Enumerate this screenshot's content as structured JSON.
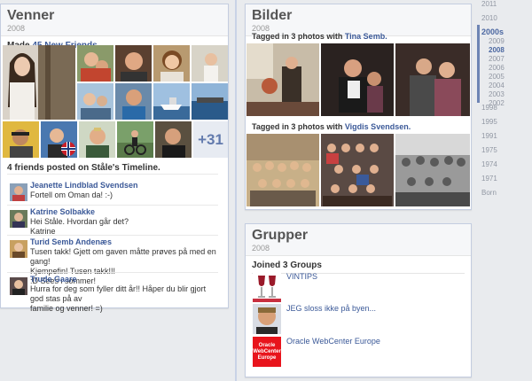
{
  "friends": {
    "title": "Venner",
    "year": "2008",
    "made_prefix": "Made",
    "made_link": "45 New Friends",
    "more_count": "+31",
    "timeline_label": "4 friends posted on Ståle's Timeline.",
    "posts": [
      {
        "name": "Jeanette Lindblad Svendsen",
        "lines": [
          "Fortell om Oman da! :-)"
        ]
      },
      {
        "name": "Katrine Solbakke",
        "lines": [
          "Hei Ståle. Hvordan går det?",
          "Katrine"
        ]
      },
      {
        "name": "Turid Semb Andenæs",
        "lines": [
          "Tusen takk! Gjett om gaven måtte prøves på med en gang!",
          "Kjempefin! Tusen takk!!!",
          ":D Sees i sommer!"
        ]
      },
      {
        "name": "Trude Gaare",
        "lines": [
          "Hurra for deg som fyller ditt år!! Håper du blir gjort god stas på av",
          "familie og venner! =)"
        ]
      }
    ]
  },
  "photos": {
    "title": "Bilder",
    "year": "2008",
    "tag1_prefix": "Tagged in 3 photos with",
    "tag1_name": "Tina Semb.",
    "tag2_prefix": "Tagged in 3 photos with",
    "tag2_name": "Vigdis Svendsen."
  },
  "groups": {
    "title": "Grupper",
    "year": "2008",
    "joined_label": "Joined 3 Groups",
    "items": [
      {
        "name": "VINTIPS"
      },
      {
        "name": "JEG sloss ikke på byen..."
      },
      {
        "name": "Oracle WebCenter Europe",
        "logo_text": "Oracle WebCenter Europe"
      }
    ]
  },
  "timeline": {
    "top": [
      "2011",
      "2010"
    ],
    "active": "2000s",
    "sub": [
      "2009",
      "2008",
      "2007",
      "2006",
      "2005",
      "2004",
      "2003",
      "2002"
    ],
    "selected_sub": "2008",
    "rest": [
      "1998",
      "1995",
      "1991",
      "1975",
      "1974",
      "1971",
      "Born"
    ]
  },
  "colors": {
    "link": "#3b5998",
    "page_bg": "#e9ebee",
    "timeline_accent": "#6d84b4"
  }
}
